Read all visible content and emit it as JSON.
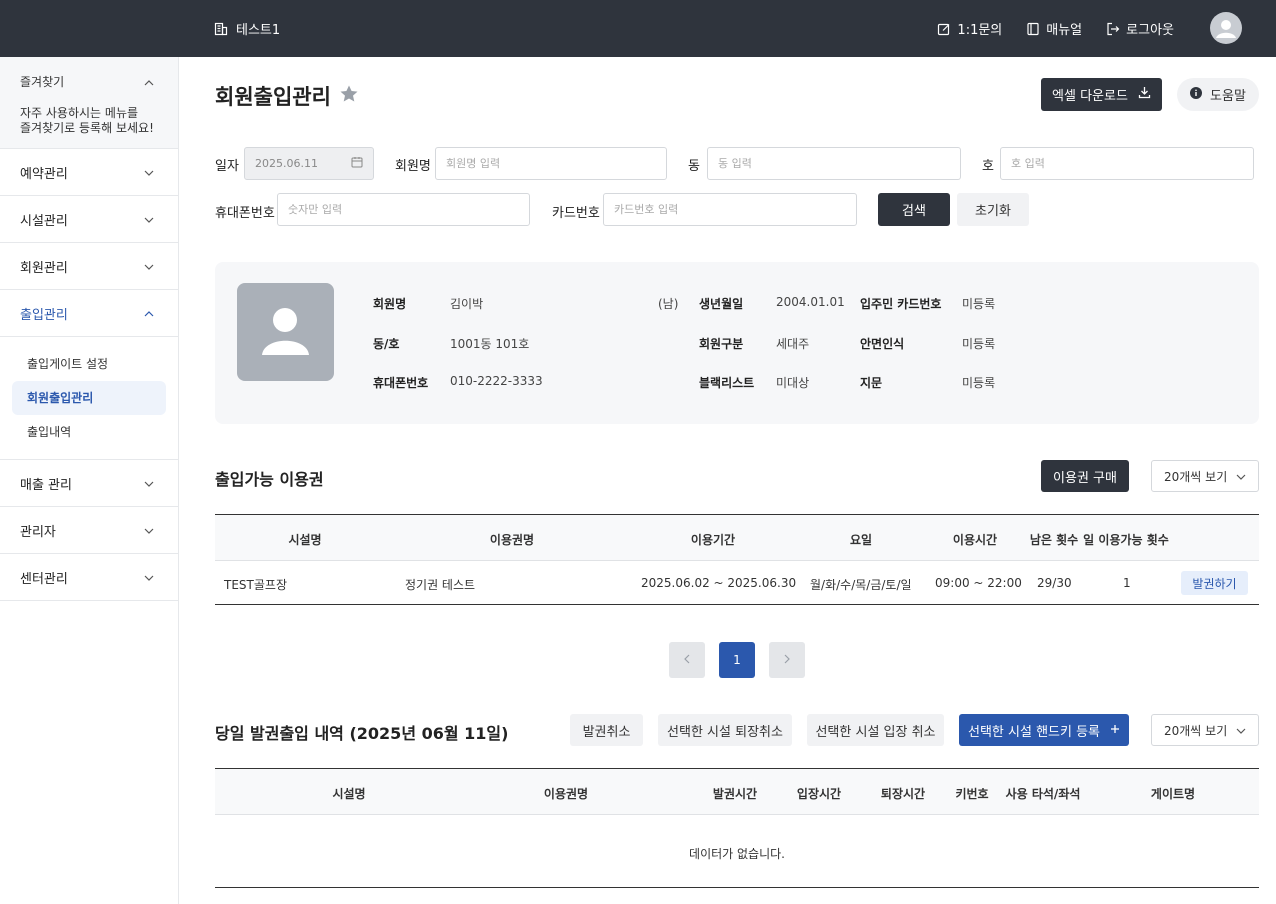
{
  "header": {
    "brand": "테스트1",
    "nav": [
      {
        "label": "1:1문의",
        "icon": "edit-icon"
      },
      {
        "label": "매뉴얼",
        "icon": "book-icon"
      },
      {
        "label": "로그아웃",
        "icon": "logout-icon"
      }
    ]
  },
  "sidebar": {
    "favorites_title": "즐겨찾기",
    "favorites_desc": "자주 사용하시는 메뉴를\n즐겨찾기로 등록해 보세요!",
    "items": [
      {
        "label": "예약관리"
      },
      {
        "label": "시설관리"
      },
      {
        "label": "회원관리"
      },
      {
        "label": "출입관리"
      },
      {
        "label": "매출 관리"
      },
      {
        "label": "관리자"
      },
      {
        "label": "센터관리"
      }
    ],
    "sub_items": [
      {
        "label": "출입게이트 설정"
      },
      {
        "label": "회원출입관리"
      },
      {
        "label": "출입내역"
      }
    ]
  },
  "page": {
    "title": "회원출입관리",
    "excel_button": "엑셀 다운로드",
    "help_button": "도움말"
  },
  "search": {
    "date_label": "일자",
    "date_value": "2025.06.11",
    "member_label": "회원명",
    "member_placeholder": "회원명 입력",
    "dong_label": "동",
    "dong_placeholder": "동 입력",
    "ho_label": "호",
    "ho_placeholder": "호 입력",
    "phone_label": "휴대폰번호",
    "phone_placeholder": "숫자만 입력",
    "card_label": "카드번호",
    "card_placeholder": "카드번호 입력",
    "search_button": "검색",
    "reset_button": "초기화"
  },
  "profile": {
    "name_key": "회원명",
    "name": "김이박",
    "gender": "(남)",
    "unit_key": "동/호",
    "unit": "1001동 101호",
    "phone_key": "휴대폰번호",
    "phone": "010-2222-3333",
    "birth_key": "생년월일",
    "birth": "2004.01.01",
    "type_key": "회원구분",
    "type": "세대주",
    "blacklist_key": "블랙리스트",
    "blacklist": "미대상",
    "card_key": "입주민 카드번호",
    "card": "미등록",
    "face_key": "안면인식",
    "face": "미등록",
    "finger_key": "지문",
    "finger": "미등록"
  },
  "tickets": {
    "title": "출입가능 이용권",
    "buy_button": "이용권 구매",
    "page_size": "20개씩 보기",
    "columns": [
      "시설명",
      "이용권명",
      "이용기간",
      "요일",
      "이용시간",
      "남은 횟수",
      "일 이용가능 횟수"
    ],
    "rows": [
      {
        "facility": "TEST골프장",
        "ticket": "정기권 테스트",
        "period": "2025.06.02 ~ 2025.06.30",
        "days": "월/화/수/목/금/토/일",
        "time": "09:00 ~ 22:00",
        "remaining": "29/30",
        "daily": "1",
        "action": "발권하기"
      }
    ]
  },
  "pagination": {
    "current": "1",
    "prev_icon": "chevron-left-icon",
    "next_icon": "chevron-right-icon"
  },
  "history": {
    "title": "당일 발권출입 내역 (2025년 06월 11일)",
    "cancel_issue": "발권취소",
    "cancel_exit": "선택한 시설 퇴장취소",
    "cancel_entry": "선택한 시설 입장 취소",
    "register_key": "선택한 시설 핸드키 등록",
    "page_size": "20개씩 보기",
    "columns": [
      "시설명",
      "이용권명",
      "발권시간",
      "입장시간",
      "퇴장시간",
      "키번호",
      "사용 타석/좌석",
      "게이트명"
    ],
    "empty": "데이터가 없습니다."
  },
  "colors": {
    "topbar": "#2f343d",
    "accent": "#2b58ad",
    "panel": "#f6f7f9"
  }
}
